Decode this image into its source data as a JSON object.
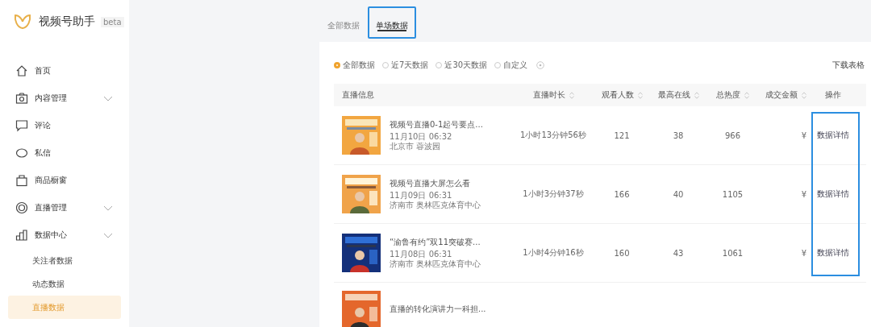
{
  "app": {
    "title": "视频号助手",
    "badge": "beta"
  },
  "sidebar": {
    "items": [
      {
        "label": "首页",
        "collapsible": false,
        "selected": false
      },
      {
        "label": "内容管理",
        "collapsible": true,
        "selected": false
      },
      {
        "label": "评论",
        "collapsible": false,
        "selected": false
      },
      {
        "label": "私信",
        "collapsible": false,
        "selected": false
      },
      {
        "label": "商品橱窗",
        "collapsible": false,
        "selected": false
      },
      {
        "label": "直播管理",
        "collapsible": true,
        "selected": false
      },
      {
        "label": "数据中心",
        "collapsible": true,
        "selected": false,
        "children": [
          {
            "label": "关注者数据",
            "selected": false
          },
          {
            "label": "动态数据",
            "selected": false
          },
          {
            "label": "直播数据",
            "selected": true
          }
        ]
      }
    ]
  },
  "tabs": [
    {
      "label": "全部数据",
      "selected": false,
      "highlighted": false
    },
    {
      "label": "单场数据",
      "selected": true,
      "highlighted": true
    }
  ],
  "filters": [
    {
      "label": "全部数据",
      "selected": true
    },
    {
      "label": "近7天数据",
      "selected": false
    },
    {
      "label": "近30天数据",
      "selected": false
    },
    {
      "label": "自定义",
      "selected": false
    }
  ],
  "download_link": "下载表格",
  "table": {
    "columns": [
      {
        "label": "直播信息",
        "sortable": false
      },
      {
        "label": "直播时长",
        "sortable": true
      },
      {
        "label": "观看人数",
        "sortable": true
      },
      {
        "label": "最高在线",
        "sortable": true
      },
      {
        "label": "总热度",
        "sortable": true
      },
      {
        "label": "成交金额",
        "sortable": true
      },
      {
        "label": "操作",
        "sortable": false
      }
    ],
    "rows": [
      {
        "title": "视频号直播0-1起号要点...",
        "date": "11月10日 06:32",
        "location": "北京市 蓉波园",
        "duration": "1小时13分钟56秒",
        "viewers": "121",
        "peak": "38",
        "heat": "966",
        "amount": "¥",
        "action": "数据详情"
      },
      {
        "title": "视频号直播大屏怎么看",
        "date": "11月09日 06:31",
        "location": "济南市 奥林匹克体育中心",
        "duration": "1小时3分钟37秒",
        "viewers": "166",
        "peak": "40",
        "heat": "1105",
        "amount": "¥",
        "action": "数据详情"
      },
      {
        "title": "“渝鲁有约”双11突破赛...",
        "date": "11月08日 06:31",
        "location": "济南市 奥林匹克体育中心",
        "duration": "1小时4分钟16秒",
        "viewers": "160",
        "peak": "43",
        "heat": "1061",
        "amount": "¥",
        "action": "数据详情"
      },
      {
        "title": "直播的转化演讲力一科担..."
      }
    ],
    "actions_highlighted": true
  }
}
